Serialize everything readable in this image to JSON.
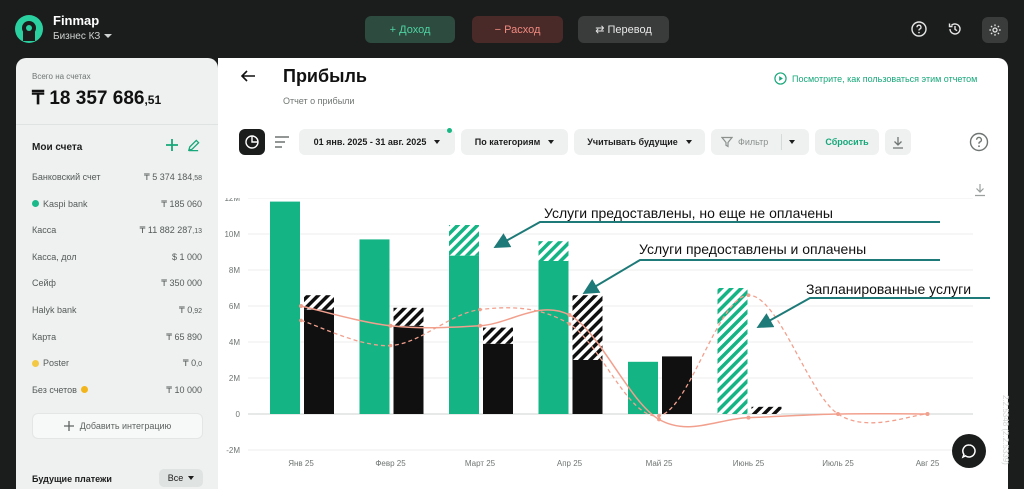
{
  "app": {
    "brand": "Finmap",
    "company": "Бизнес КЗ"
  },
  "topbar": {
    "income_label": "+ Доход",
    "expense_label": "− Расход",
    "transfer_label": "⇄ Перевод",
    "icons": [
      "help-circle-icon",
      "history-icon",
      "gear-icon"
    ]
  },
  "sidebar": {
    "total_label": "Всего на счетах",
    "total_main": "₸ 18 357 686",
    "total_dec": ",51",
    "accounts_title": "Мои счета",
    "accounts": [
      {
        "name": "Банковский счет",
        "amount": "₸ 5 374 184",
        "dec": ",58",
        "dot": ""
      },
      {
        "name": "Kaspi bank",
        "amount": "₸ 185 060",
        "dec": "",
        "dot": "#19b98a"
      },
      {
        "name": "Касса",
        "amount": "₸ 11 882 287",
        "dec": ",13",
        "dot": ""
      },
      {
        "name": "Касса, дол",
        "amount": "$ 1 000",
        "dec": "",
        "dot": ""
      },
      {
        "name": "Сейф",
        "amount": "₸ 350 000",
        "dec": "",
        "dot": ""
      },
      {
        "name": "Halyk bank",
        "amount": "₸ 0",
        "dec": ",92",
        "dot": ""
      },
      {
        "name": "Карта",
        "amount": "₸ 65 890",
        "dec": "",
        "dot": ""
      },
      {
        "name": "Poster",
        "amount": "₸ 0",
        "dec": ",0",
        "dot": "#f3c843"
      },
      {
        "name": "Без счетов",
        "amount": "₸ 10 000",
        "dec": "",
        "dot": "#f3b51c"
      }
    ],
    "integration_label": "Добавить интеграцию",
    "future_title": "Будущие платежи",
    "future_select": "Все"
  },
  "main": {
    "title": "Прибыль",
    "subtitle": "Отчет о прибыли",
    "help_link": "Посмотрите, как пользоваться этим отчетом",
    "toolbar": {
      "period": "01 янв. 2025 - 31 авг. 2025",
      "group": "По категориям",
      "future": "Учитывать будущие",
      "filter": "Фильтр",
      "reset": "Сбросить"
    }
  },
  "annotations": {
    "unpaid": "Услуги предоставлены, но еще не оплачены",
    "paid": "Услуги предоставлены и оплачены",
    "planned": "Запланированные услуги"
  },
  "version": "2.2.5348 (2.2.5339)",
  "colors": {
    "income": "#14b484",
    "expense": "#101010",
    "accent": "#18a77a",
    "line": "#f2a08e"
  },
  "chart_data": {
    "type": "bar",
    "categories": [
      "Янв 25",
      "Февр 25",
      "Март 25",
      "Апр 25",
      "Май 25",
      "Июнь 25",
      "Июль 25",
      "Авг 25"
    ],
    "y_ticks": [
      "12M",
      "10M",
      "8M",
      "6M",
      "4M",
      "2M",
      "0",
      "-2M"
    ],
    "ylim": [
      -2000000,
      12000000
    ],
    "series": [
      {
        "kind": "income",
        "values": [
          11800000,
          9700000,
          8800000,
          8500000,
          2900000,
          0,
          0,
          0
        ],
        "planned": [
          0,
          0,
          1700000,
          1100000,
          0,
          7000000,
          0,
          0
        ]
      },
      {
        "kind": "expense",
        "values": [
          5800000,
          4900000,
          3900000,
          3000000,
          3200000,
          0,
          0,
          0
        ],
        "planned": [
          800000,
          1000000,
          900000,
          3600000,
          0,
          400000,
          0,
          0
        ]
      }
    ],
    "lines": {
      "solid": [
        6000000,
        4900000,
        4900000,
        5500000,
        -300000,
        -200000,
        0,
        0
      ],
      "dashed": [
        5200000,
        3800000,
        5800000,
        5000000,
        -100000,
        6600000,
        0,
        0
      ]
    }
  }
}
